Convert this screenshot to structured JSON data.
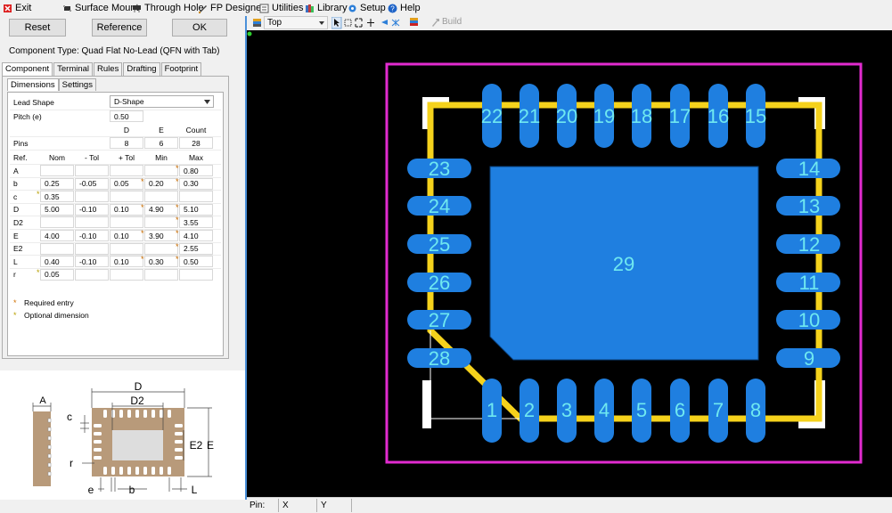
{
  "menu": {
    "exit": "Exit",
    "surface_mount": "Surface Mount",
    "through_hole": "Through Hole",
    "fp_designer": "FP Designer",
    "utilities": "Utilities",
    "library": "Library",
    "setup": "Setup",
    "help": "Help"
  },
  "buttons": {
    "reset": "Reset",
    "reference": "Reference",
    "ok": "OK"
  },
  "component_type": "Component Type: Quad Flat No-Lead (QFN with Tab)",
  "tabs": [
    "Component",
    "Terminal",
    "Rules",
    "Drafting",
    "Footprint"
  ],
  "subtabs": [
    "Dimensions",
    "Settings"
  ],
  "lead_shape": {
    "label": "Lead Shape",
    "value": "D-Shape"
  },
  "pitch": {
    "label": "Pitch (e)",
    "value": "0.50"
  },
  "pins_table": {
    "headers": [
      "D",
      "E",
      "Count"
    ],
    "row_label": "Pins",
    "values": [
      "8",
      "6",
      "28"
    ]
  },
  "dim_headers": [
    "Ref.",
    "Nom",
    "- Tol",
    "+ Tol",
    "Min",
    "Max"
  ],
  "dims": [
    {
      "ref": "A",
      "nom": "",
      "mtol": "",
      "ptol": "",
      "min": "",
      "max": "0.80"
    },
    {
      "ref": "b",
      "nom": "0.25",
      "mtol": "-0.05",
      "ptol": "0.05",
      "min": "0.20",
      "max": "0.30"
    },
    {
      "ref": "c",
      "nom": "0.35",
      "mtol": "",
      "ptol": "",
      "min": "",
      "max": ""
    },
    {
      "ref": "D",
      "nom": "5.00",
      "mtol": "-0.10",
      "ptol": "0.10",
      "min": "4.90",
      "max": "5.10"
    },
    {
      "ref": "D2",
      "nom": "",
      "mtol": "",
      "ptol": "",
      "min": "",
      "max": "3.55"
    },
    {
      "ref": "E",
      "nom": "4.00",
      "mtol": "-0.10",
      "ptol": "0.10",
      "min": "3.90",
      "max": "4.10"
    },
    {
      "ref": "E2",
      "nom": "",
      "mtol": "",
      "ptol": "",
      "min": "",
      "max": "2.55"
    },
    {
      "ref": "L",
      "nom": "0.40",
      "mtol": "-0.10",
      "ptol": "0.10",
      "min": "0.30",
      "max": "0.50"
    },
    {
      "ref": "r",
      "nom": "0.05",
      "mtol": "",
      "ptol": "",
      "min": "",
      "max": ""
    }
  ],
  "legend": {
    "required": "Required entry",
    "optional": "Optional dimension"
  },
  "drawing_labels": {
    "A": "A",
    "D": "D",
    "D2": "D2",
    "E": "E",
    "E2": "E2",
    "c": "c",
    "r": "r",
    "e": "e",
    "b": "b",
    "L": "L"
  },
  "toolbar": {
    "layer": "Top",
    "build": "Build"
  },
  "canvas": {
    "pad_labels_bottom": [
      "1",
      "2",
      "3",
      "4",
      "5",
      "6",
      "7",
      "8"
    ],
    "pad_labels_right": [
      "9",
      "10",
      "11",
      "12",
      "13",
      "14"
    ],
    "pad_labels_top": [
      "15",
      "16",
      "17",
      "18",
      "19",
      "20",
      "21",
      "22"
    ],
    "pad_labels_left": [
      "23",
      "24",
      "25",
      "26",
      "27",
      "28"
    ],
    "center_pad": "29",
    "colors": {
      "pad": "#1f7fe0",
      "silk": "#f5d21c",
      "courtyard": "#e22bd0",
      "label": "#6fe8f0"
    }
  },
  "status": {
    "pin": "Pin:",
    "x": "X",
    "y": "Y"
  },
  "icons": [
    "exit-icon",
    "surface-mount-icon",
    "through-hole-icon",
    "fp-designer-icon",
    "utilities-icon",
    "library-icon",
    "setup-icon",
    "help-icon"
  ]
}
